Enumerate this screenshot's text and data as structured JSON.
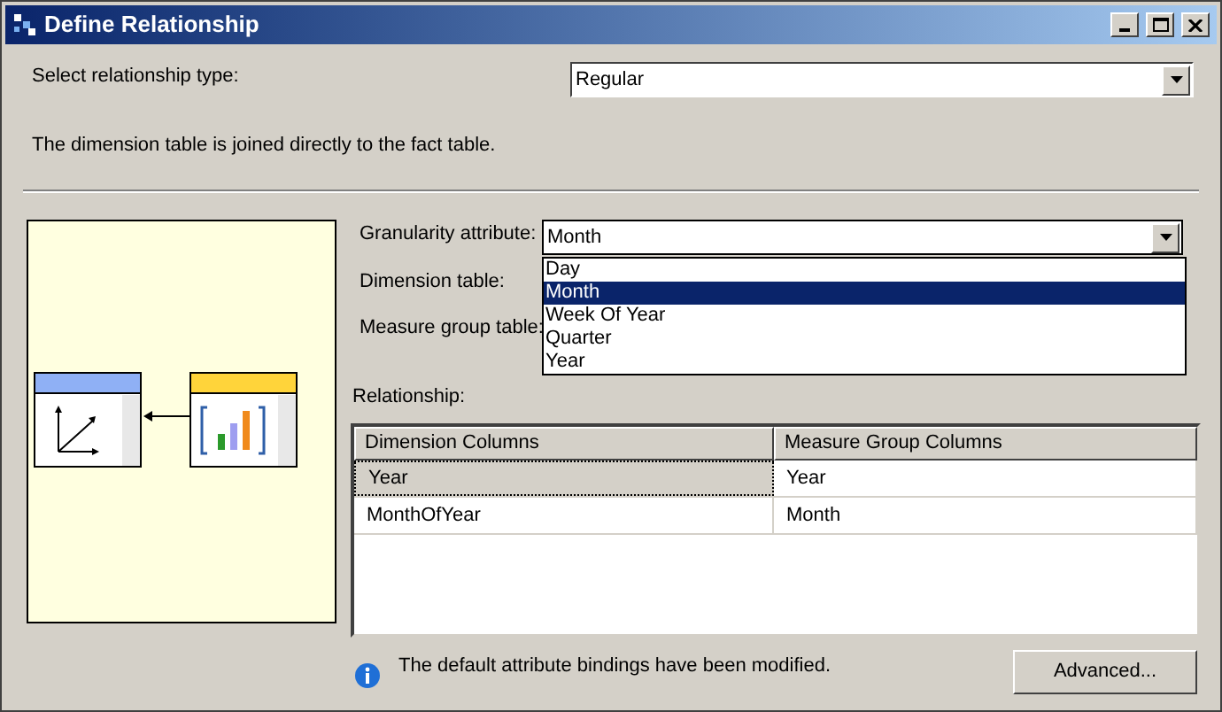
{
  "window": {
    "title": "Define Relationship"
  },
  "relationship_type": {
    "label": "Select relationship type:",
    "value": "Regular"
  },
  "description": "The dimension table is joined directly to the fact table.",
  "granularity": {
    "label": "Granularity attribute:",
    "value": "Month",
    "expanded": true,
    "options": [
      {
        "label": "Day",
        "selected": false
      },
      {
        "label": "Month",
        "selected": true
      },
      {
        "label": "Week Of Year",
        "selected": false
      },
      {
        "label": "Quarter",
        "selected": false
      },
      {
        "label": "Year",
        "selected": false
      }
    ]
  },
  "dimension_table": {
    "label": "Dimension table:"
  },
  "measure_group_table": {
    "label": "Measure group table:"
  },
  "relationship": {
    "label": "Relationship:",
    "columns": [
      "Dimension Columns",
      "Measure Group Columns"
    ],
    "rows": [
      {
        "cells": [
          "Year",
          "Year"
        ],
        "selected": true
      },
      {
        "cells": [
          "MonthOfYear",
          "Month"
        ],
        "selected": false
      }
    ]
  },
  "info": "The default attribute bindings have been modified.",
  "buttons": [
    "Advanced..."
  ]
}
